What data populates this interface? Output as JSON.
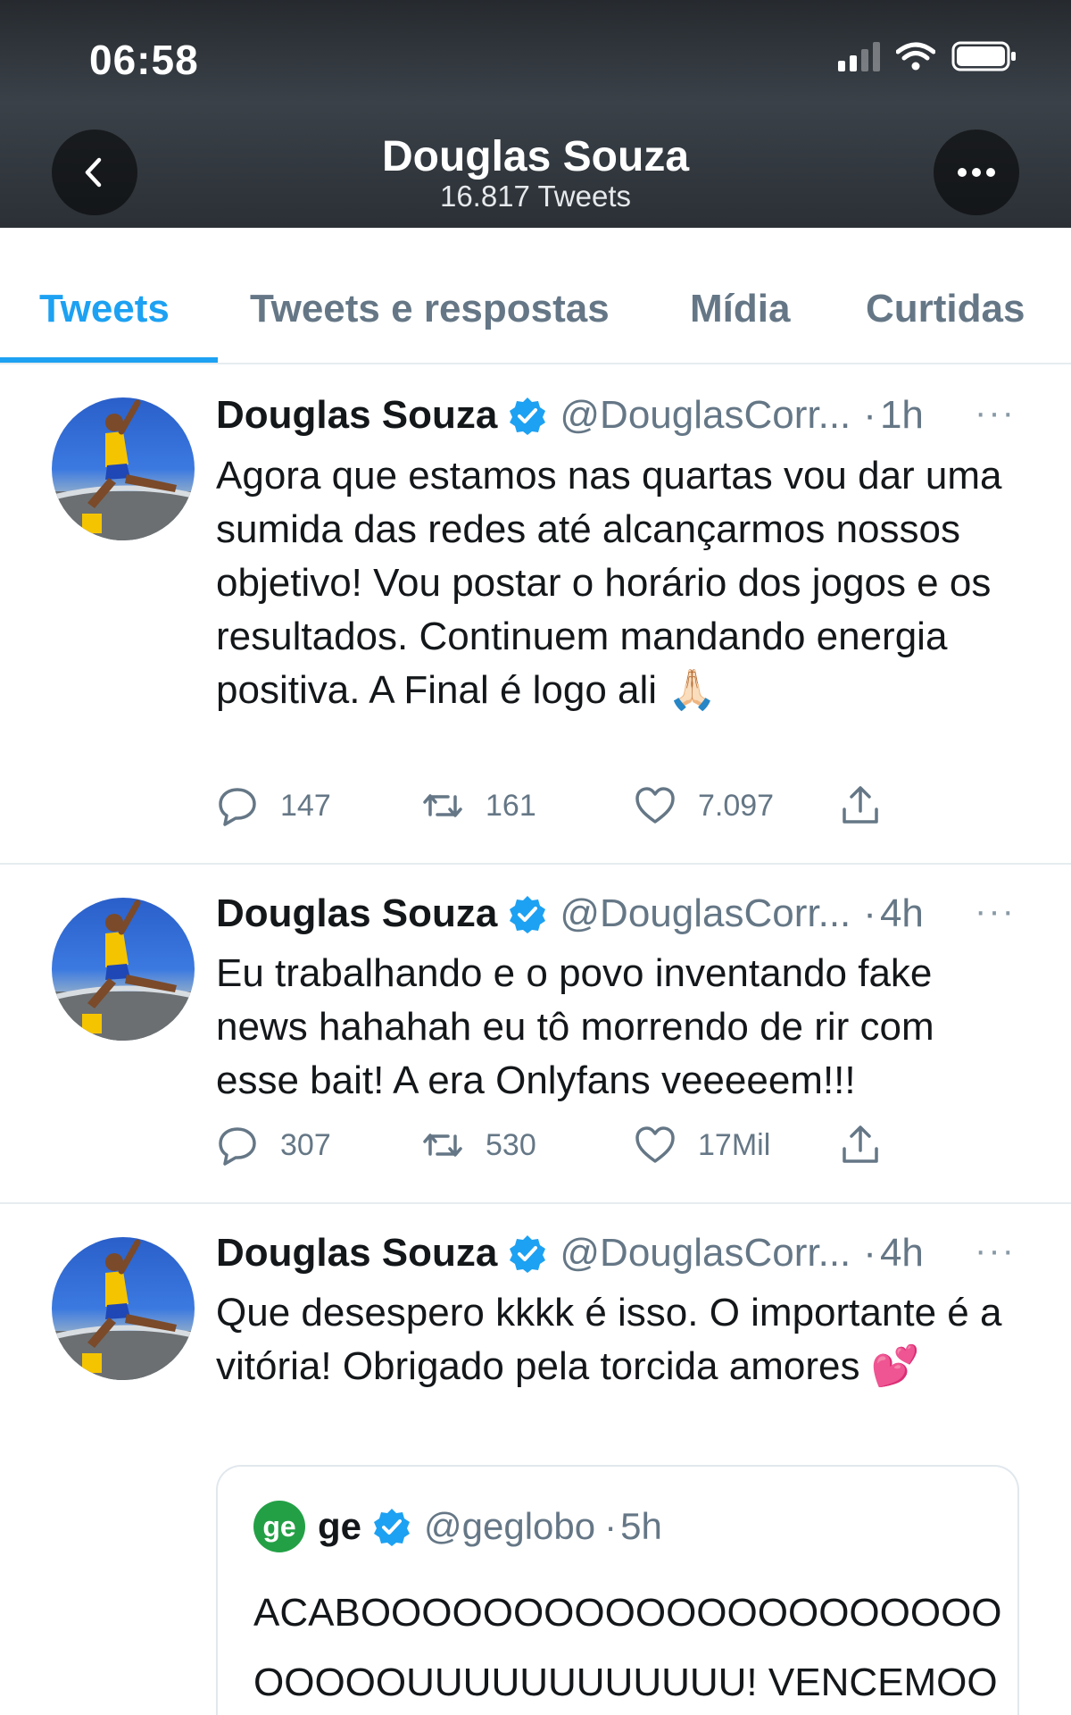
{
  "status_bar": {
    "time": "06:58"
  },
  "header": {
    "title": "Douglas Souza",
    "subtitle": "16.817 Tweets",
    "back_icon": "chevron-left-icon",
    "more_icon": "more-icon"
  },
  "tabs": [
    {
      "label": "Tweets",
      "active": true
    },
    {
      "label": "Tweets e respostas",
      "active": false
    },
    {
      "label": "Mídia",
      "active": false
    },
    {
      "label": "Curtidas",
      "active": false
    }
  ],
  "colors": {
    "accent": "#1da1f2",
    "muted": "#657786",
    "text": "#14171a",
    "divider": "#e6ecf0"
  },
  "tweets": [
    {
      "name": "Douglas Souza",
      "handle": "@DouglasCorr...",
      "sep": "·",
      "time": "1h",
      "menu": "···",
      "text": "Agora que estamos nas quartas vou dar uma sumida das redes até alcançarmos nossos objetivo! Vou postar o horário dos jogos e os resultados. Continuem mandando energia positiva. A Final é logo ali 🙏🏻",
      "replies": "147",
      "retweets": "161",
      "likes": "7.097"
    },
    {
      "name": "Douglas Souza",
      "handle": "@DouglasCorr...",
      "sep": "·",
      "time": "4h",
      "menu": "···",
      "text": "Eu trabalhando e o povo inventando fake news hahahah eu tô morrendo de rir com esse bait! A era Onlyfans veeeeem!!!",
      "replies": "307",
      "retweets": "530",
      "likes": "17Mil"
    },
    {
      "name": "Douglas Souza",
      "handle": "@DouglasCorr...",
      "sep": "·",
      "time": "4h",
      "menu": "···",
      "text": "Que desespero kkkk é isso. O importante é a vitória! Obrigado pela torcida amores 💕",
      "quote": {
        "logo_text": "ge",
        "name": "ge",
        "handle": "@geglobo",
        "sep": "·",
        "time": "5h",
        "text": "ACABOOOOOOOOOOOOOOOOOOOOOOOOOOUUUUUUUUUUUU! VENCEMOOOOOOOOOOOOOOOOOOOO"
      }
    }
  ]
}
